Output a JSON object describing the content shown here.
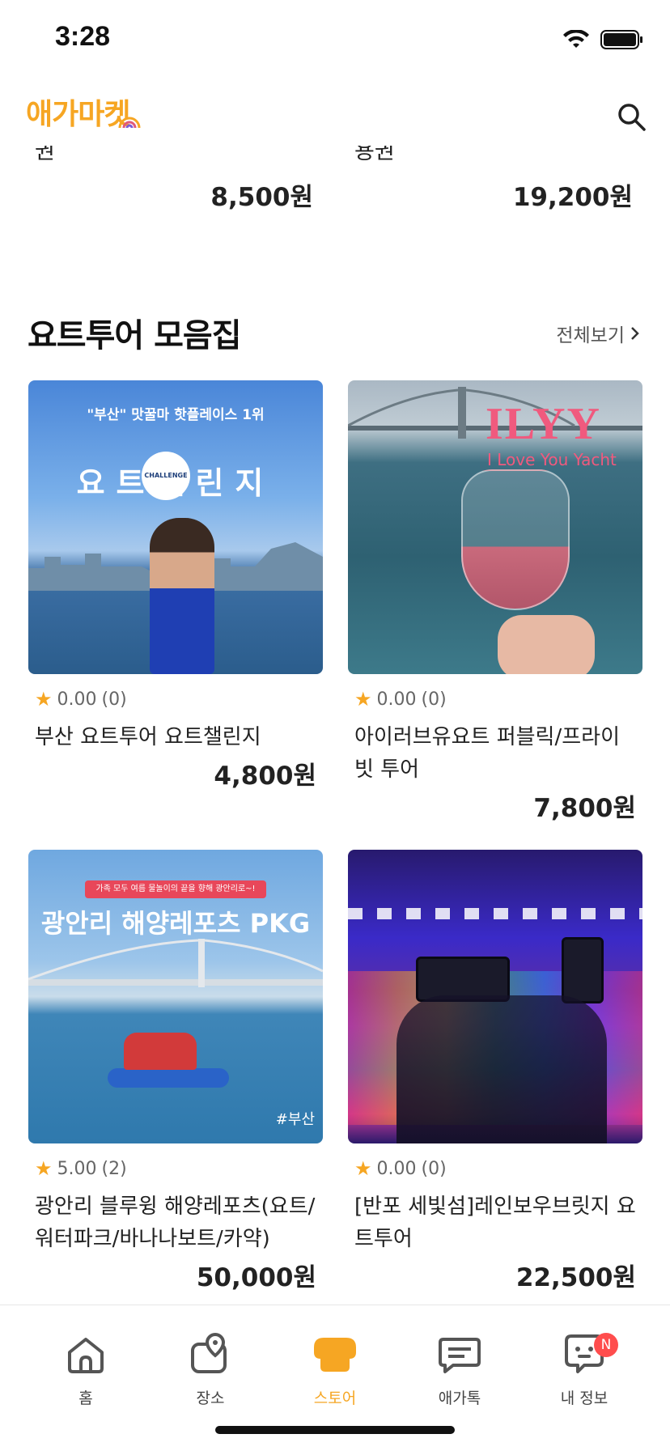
{
  "status": {
    "time": "3:28"
  },
  "header": {
    "logo_text": "애가마켓"
  },
  "prev_row": [
    {
      "title_tail": "권",
      "price": "8,500원"
    },
    {
      "title_tail": "용권",
      "price": "19,200원"
    }
  ],
  "section": {
    "title": "요트투어 모음집",
    "see_all": "전체보기"
  },
  "cards": [
    {
      "image_title": "요트챌린지",
      "image_banner": "\"부산\" 맛꿀마 핫플레이스 1위",
      "image_logo": "CHALLENGE",
      "rating": "0.00",
      "count": "(0)",
      "title": "부산 요트투어 요트챌린지",
      "price": "4,800원"
    },
    {
      "image_title": "ILYY",
      "image_subtitle": "I Love You Yacht",
      "rating": "0.00",
      "count": "(0)",
      "title": "아이러브유요트 퍼블릭/프라이빗 투어",
      "price": "7,800원"
    },
    {
      "image_banner": "가족 모두 여름 물놀이의 끝을 향해 광안리로~!",
      "image_title": "광안리 해양레포츠 PKG",
      "image_tag": "#부산",
      "rating": "5.00",
      "count": "(2)",
      "title": "광안리 블루윙 해양레포츠(요트/워터파크/바나나보트/카약)",
      "price": "50,000원"
    },
    {
      "rating": "0.00",
      "count": "(0)",
      "title": "[반포 세빛섬]레인보우브릿지 요트투어",
      "price": "22,500원"
    }
  ],
  "tabs": [
    {
      "label": "홈",
      "icon": "home-icon"
    },
    {
      "label": "장소",
      "icon": "map-pin-icon"
    },
    {
      "label": "스토어",
      "icon": "store-icon",
      "active": true
    },
    {
      "label": "애가톡",
      "icon": "chat-icon"
    },
    {
      "label": "내 정보",
      "icon": "profile-icon",
      "badge": "N"
    }
  ],
  "colors": {
    "accent": "#f6a623",
    "star": "#f6a623",
    "badge": "#ff4d4d"
  }
}
